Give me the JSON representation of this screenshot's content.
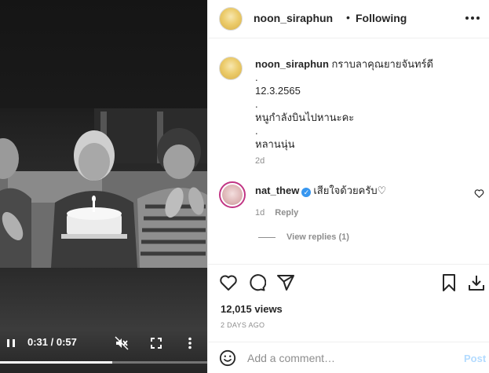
{
  "video": {
    "time": "0:31 / 0:57",
    "progress_fraction": 0.54
  },
  "header": {
    "username": "noon_siraphun",
    "separator": "•",
    "follow_label": "Following"
  },
  "caption": {
    "username": "noon_siraphun",
    "first_text": "กราบลาคุณยายจันทร์ดี",
    "lines": [
      ".",
      "12.3.2565",
      ".",
      "หนูกำลังบินไปหานะคะ",
      ".",
      "หลานนุ่น"
    ],
    "time": "2d"
  },
  "comment": {
    "username": "nat_thew",
    "verified_mark": "✓",
    "text": "เสียใจด้วยครับ♡",
    "time": "1d",
    "reply_label": "Reply",
    "view_replies": "View replies (1)"
  },
  "stats": {
    "views": "12,015 views",
    "date": "2 DAYS AGO"
  },
  "comment_bar": {
    "placeholder": "Add a comment…",
    "post_label": "Post"
  },
  "colors": {
    "accent": "#3897f0",
    "post_disabled": "#b3dbff",
    "muted": "#8e8e8e",
    "story_ring": "#c13584"
  },
  "icons": [
    "pause-icon",
    "mute-icon",
    "fullscreen-icon",
    "more-vertical-icon",
    "more-horizontal-icon",
    "heart-icon",
    "comment-icon",
    "share-icon",
    "save-icon",
    "download-icon",
    "emoji-icon",
    "verified-icon"
  ]
}
